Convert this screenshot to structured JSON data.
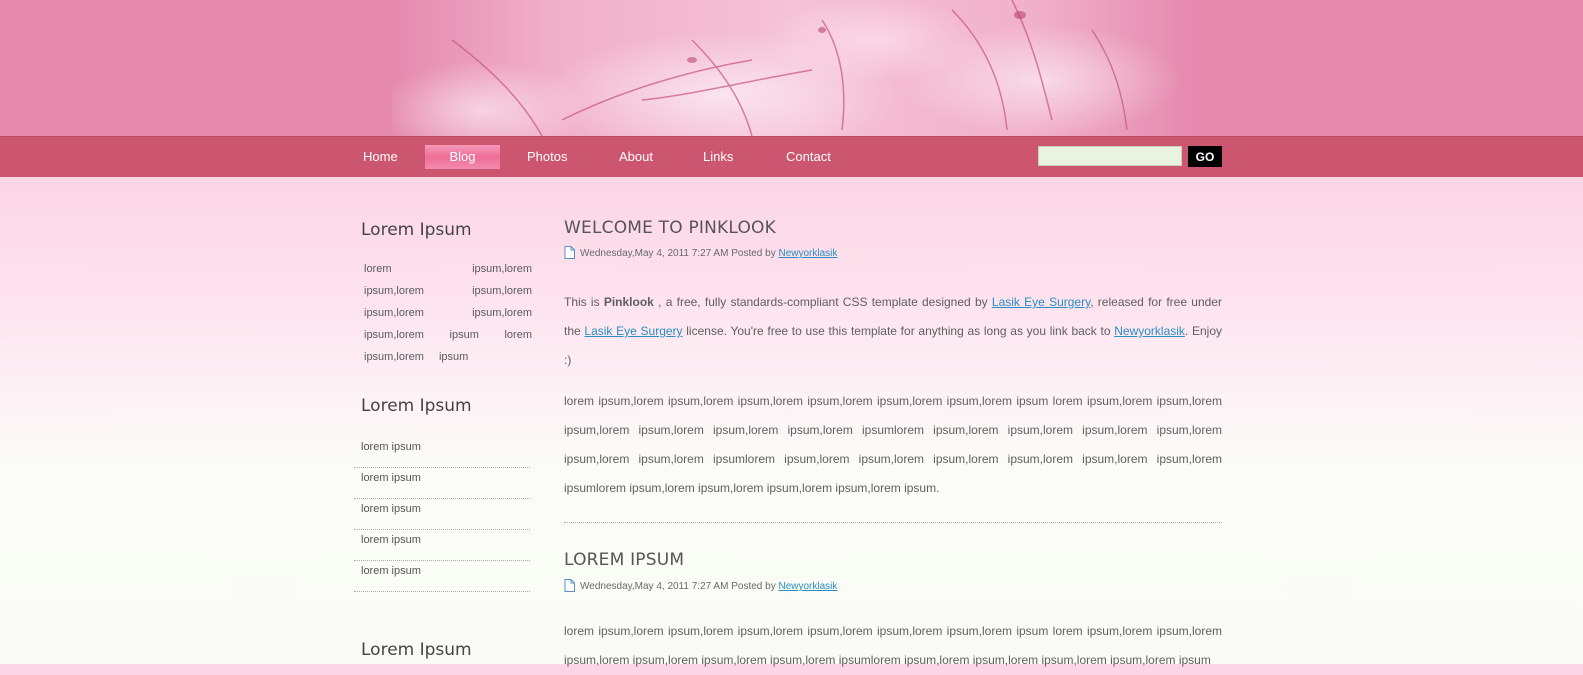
{
  "nav": {
    "items": [
      {
        "label": "Home"
      },
      {
        "label": "Blog"
      },
      {
        "label": "Photos"
      },
      {
        "label": "About"
      },
      {
        "label": "Links"
      },
      {
        "label": "Contact"
      }
    ],
    "active": "Blog"
  },
  "search": {
    "value": "",
    "placeholder": "",
    "button_label": "GO"
  },
  "sidebar": {
    "heading1": "Lorem Ipsum",
    "tags_text": "lorem ipsum,lorem ipsum,lorem ipsum,lorem ipsum,lorem ipsum,lorem ipsum,lorem ipsum lorem ipsum,lorem ipsum",
    "heading2": "Lorem Ipsum",
    "list": [
      "lorem ipsum",
      "lorem ipsum",
      "lorem ipsum",
      "lorem ipsum",
      "lorem ipsum"
    ],
    "heading3": "Lorem Ipsum"
  },
  "posts": [
    {
      "title": "WELCOME TO PINKLOOK",
      "date": "Wednesday,May 4, 2011 7:27 AM",
      "posted_by": "Posted by",
      "author": "Newyorklasik",
      "intro": {
        "t1": "This is ",
        "brand": "Pinklook",
        "t2": " , a free, fully standards-compliant CSS template designed by ",
        "link1": "Lasik Eye Surgery",
        "t3": ", released for free under the ",
        "link2": "Lasik Eye Surgery",
        "t4": " license. You're free to use this template for anything as long as you link back to ",
        "link3": "Newyorklasik",
        "t5": ". Enjoy :)"
      },
      "body": "lorem ipsum,lorem ipsum,lorem ipsum,lorem ipsum,lorem ipsum,lorem ipsum,lorem ipsum lorem ipsum,lorem ipsum,lorem ipsum,lorem ipsum,lorem ipsum,lorem ipsum,lorem ipsumlorem ipsum,lorem ipsum,lorem ipsum,lorem ipsum,lorem ipsum,lorem ipsum,lorem ipsumlorem ipsum,lorem ipsum,lorem ipsum,lorem ipsum,lorem ipsum,lorem ipsum,lorem ipsumlorem ipsum,lorem ipsum,lorem ipsum,lorem ipsum,lorem ipsum."
    },
    {
      "title": "LOREM IPSUM",
      "date": "Wednesday,May 4, 2011 7:27 AM",
      "posted_by": "Posted by",
      "author": "Newyorklasik",
      "body": "lorem ipsum,lorem ipsum,lorem ipsum,lorem ipsum,lorem ipsum,lorem ipsum,lorem ipsum lorem ipsum,lorem ipsum,lorem ipsum,lorem ipsum,lorem ipsum,lorem ipsum,lorem ipsumlorem ipsum,lorem ipsum,lorem ipsum,lorem ipsum,lorem ipsum"
    }
  ],
  "colors": {
    "banner": "#e589ad",
    "nav_bar": "#cc566f",
    "nav_active": "#ef6d96",
    "link": "#2a8ec2",
    "search_bg": "#eaf3e1",
    "go_button": "#000000"
  },
  "icons": {
    "post_meta": "document-icon"
  }
}
